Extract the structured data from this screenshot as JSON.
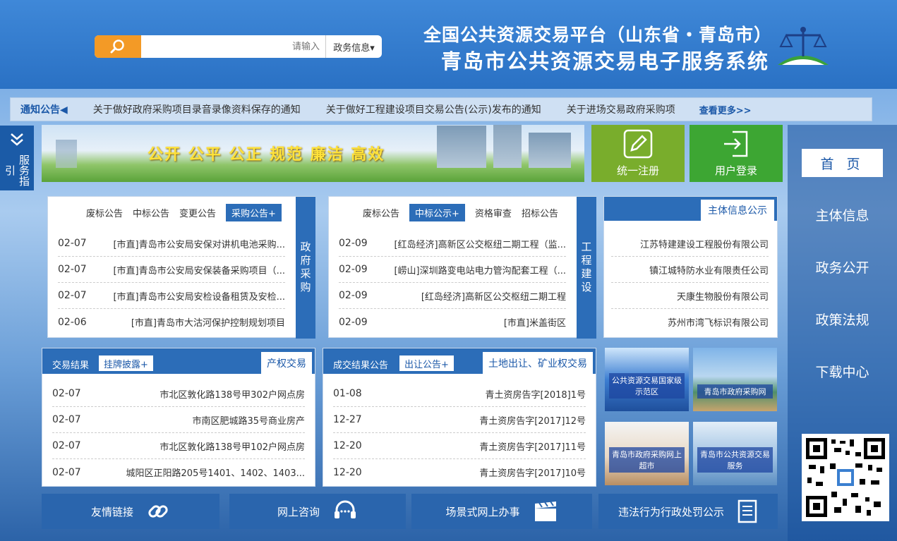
{
  "header": {
    "title_line1": "全国公共资源交易平台（山东省・青岛市）",
    "title_line2": "青岛市公共资源交易电子服务系统",
    "search": {
      "category": "政务信息▾",
      "placeholder": "请输入"
    }
  },
  "notice": {
    "label": "通知公告◀",
    "items": [
      "关于做好政府采购项目录音录像资料保存的通知",
      "关于做好工程建设项目交易公告(公示)发布的通知",
      "关于进场交易政府采购项"
    ],
    "more": "查看更多>>"
  },
  "service_guide": {
    "label": "服务指引"
  },
  "banner": {
    "slogan": "公开 公平 公正 规范 廉洁 高效"
  },
  "tiles": {
    "login": "用户登录",
    "register": "统一注册"
  },
  "nav": {
    "items": [
      "首 页",
      "主体信息",
      "政务公开",
      "政策法规",
      "下载中心"
    ]
  },
  "gov_purchase": {
    "label": "政府采购",
    "tabs": [
      "采购公告+",
      "变更公告",
      "中标公告",
      "废标公告"
    ],
    "rows": [
      {
        "name": "[市直]青岛市公安局安保对讲机电池采购...",
        "date": "02-07"
      },
      {
        "name": "[市直]青岛市公安局安保装备采购项目（...",
        "date": "02-07"
      },
      {
        "name": "[市直]青岛市公安局安检设备租赁及安检...",
        "date": "02-07"
      },
      {
        "name": "[市直]青岛市大沽河保护控制规划项目",
        "date": "02-06"
      }
    ]
  },
  "engineering": {
    "label": "工程建设",
    "tabs": [
      "招标公告",
      "资格审查",
      "中标公示+",
      "废标公告"
    ],
    "rows": [
      {
        "name": "[红岛经济]高新区公交枢纽二期工程（监...",
        "date": "02-09"
      },
      {
        "name": "[崂山]深圳路变电站电力管沟配套工程（...",
        "date": "02-09"
      },
      {
        "name": "[红岛经济]高新区公交枢纽二期工程",
        "date": "02-09"
      },
      {
        "name": "[市直]米盖街区",
        "date": "02-09"
      }
    ]
  },
  "entity_notice": {
    "title": "主体信息公示",
    "rows": [
      "江苏特建建设工程股份有限公司",
      "镇江城特防水业有限责任公司",
      "天康生物股份有限公司",
      "苏州市湾飞标识有限公司"
    ]
  },
  "land": {
    "title": "土地出让、矿业权交易",
    "tab": "出让公告+",
    "text": "成交结果公告",
    "rows": [
      {
        "name": "青土资房告字[2018]1号",
        "date": "01-08"
      },
      {
        "name": "青土资房告字[2017]12号",
        "date": "12-27"
      },
      {
        "name": "青土资房告字[2017]11号",
        "date": "12-20"
      },
      {
        "name": "青土资房告字[2017]10号",
        "date": "12-20"
      }
    ]
  },
  "property": {
    "title": "产权交易",
    "tab": "挂牌披露+",
    "text": "交易结果",
    "rows": [
      {
        "name": "市北区敦化路138号甲302户网点房",
        "date": "02-07"
      },
      {
        "name": "市南区肥城路35号商业房产",
        "date": "02-07"
      },
      {
        "name": "市北区敦化路138号甲102户网点房",
        "date": "02-07"
      },
      {
        "name": "城阳区正阳路205号1401、1402、1403...",
        "date": "02-07"
      }
    ]
  },
  "photos": [
    {
      "label": "青岛市政府采购网"
    },
    {
      "label": "公共资源交易国家级示范区"
    },
    {
      "label": "青岛市政府采购网上超市"
    },
    {
      "label": "青岛市公共资源交易服务"
    }
  ],
  "bottom_buttons": [
    {
      "label": "违法行为行政处罚公示",
      "icon": "document-list-icon"
    },
    {
      "label": "场景式网上办事",
      "icon": "clapperboard-icon"
    },
    {
      "label": "网上咨询",
      "icon": "headset-icon"
    },
    {
      "label": "友情链接",
      "icon": "chain-link-icon"
    }
  ],
  "colors": {
    "primary": "#2c6db8",
    "search_button": "#f39a26",
    "login": "#3da633",
    "register": "#79ad2c"
  }
}
